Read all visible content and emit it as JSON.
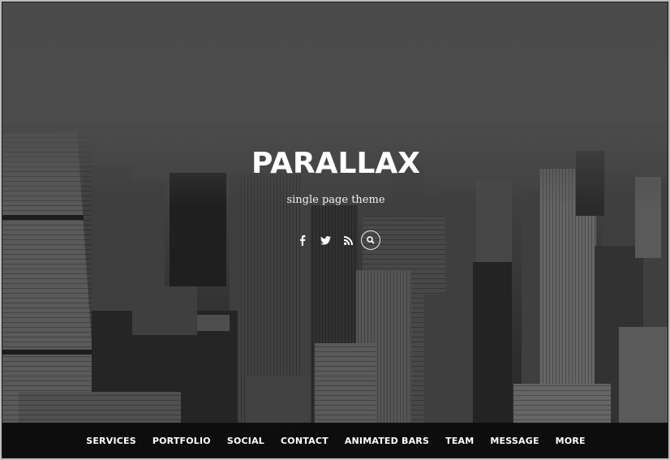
{
  "hero": {
    "title": "PARALLAX",
    "subtitle": "single page theme"
  },
  "social": [
    {
      "name": "facebook-icon",
      "glyph": "f"
    },
    {
      "name": "twitter-icon",
      "glyph": "twitter"
    },
    {
      "name": "rss-icon",
      "glyph": "rss"
    },
    {
      "name": "search-icon",
      "glyph": "search"
    }
  ],
  "nav": {
    "items": [
      {
        "label": "SERVICES"
      },
      {
        "label": "PORTFOLIO"
      },
      {
        "label": "SOCIAL"
      },
      {
        "label": "CONTACT"
      },
      {
        "label": "ANIMATED BARS"
      },
      {
        "label": "TEAM"
      },
      {
        "label": "MESSAGE"
      },
      {
        "label": "MORE"
      }
    ]
  },
  "colors": {
    "nav_bg": "#0c0c0c",
    "text": "#ffffff"
  }
}
